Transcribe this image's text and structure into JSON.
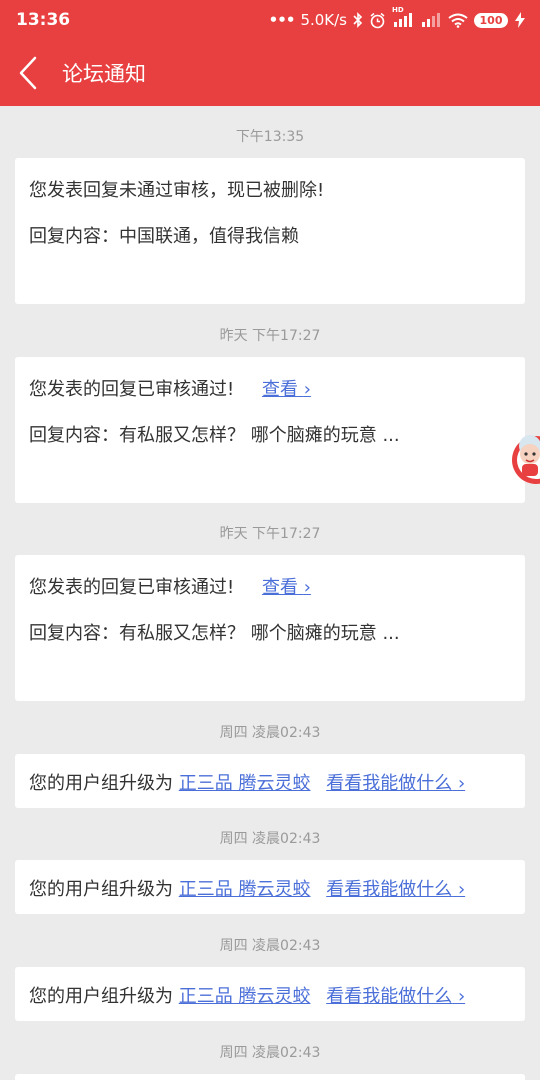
{
  "status_bar": {
    "time": "13:36",
    "network_speed": "5.0K/s",
    "battery": "100",
    "hd_label": "HD"
  },
  "header": {
    "title": "论坛通知"
  },
  "notifications": [
    {
      "time": "下午13:35",
      "line1": "您发表回复未通过审核，现已被删除!",
      "line2": "回复内容：中国联通，值得我信赖"
    },
    {
      "time": "昨天 下午17:27",
      "line1": "您发表的回复已审核通过!",
      "link": "查看",
      "line2": "回复内容：有私服又怎样？ 哪个脑瘫的玩意 ..."
    },
    {
      "time": "昨天 下午17:27",
      "line1": "您发表的回复已审核通过!",
      "link": "查看",
      "line2": "回复内容：有私服又怎样？ 哪个脑瘫的玩意 ..."
    },
    {
      "time": "周四 凌晨02:43",
      "prefix": "您的用户组升级为",
      "rank": "正三品 腾云灵蛟",
      "link": "看看我能做什么"
    },
    {
      "time": "周四 凌晨02:43",
      "prefix": "您的用户组升级为",
      "rank": "正三品 腾云灵蛟",
      "link": "看看我能做什么"
    },
    {
      "time": "周四 凌晨02:43",
      "prefix": "您的用户组升级为",
      "rank": "正三品 腾云灵蛟",
      "link": "看看我能做什么"
    },
    {
      "time": "周四 凌晨02:43"
    }
  ],
  "chevron_glyph": "›",
  "colors": {
    "brand_red": "#e84040",
    "link_blue": "#4b6fd8",
    "background": "#ebebeb"
  }
}
